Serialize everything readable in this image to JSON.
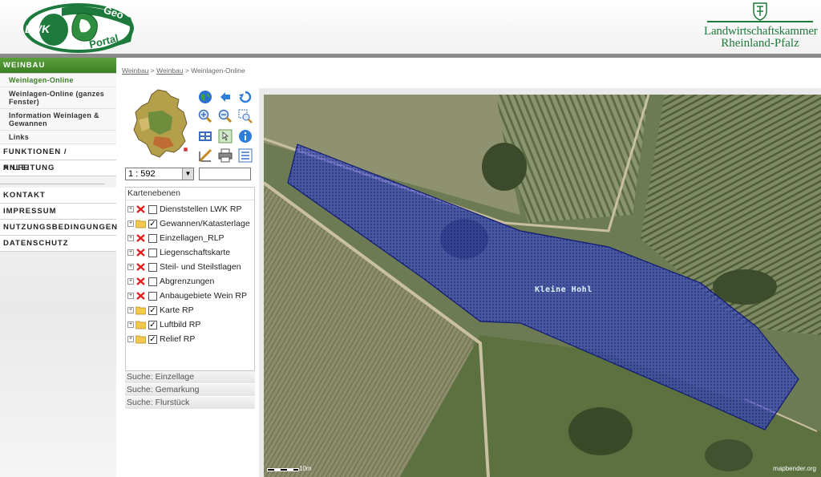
{
  "header": {
    "geo_logo": {
      "lwk": "LWK",
      "geo": "Geo",
      "portal": "Portal"
    },
    "lwk_logo": {
      "line1": "Landwirtschaftskammer",
      "line2": "Rheinland-Pfalz"
    }
  },
  "nav": {
    "weinbau": "WEINBAU",
    "sub": [
      "Weinlagen-Online",
      "Weinlagen-Online (ganzes Fenster)",
      "Information Weinlagen & Gewannen",
      "Links"
    ],
    "funktionen": "FUNKTIONEN / ANLEITUNG",
    "hilfe": "HILFE",
    "kontakt": "KONTAKT",
    "impressum": "IMPRESSUM",
    "nutzung": "NUTZUNGSBEDINGUNGEN",
    "datenschutz": "DATENSCHUTZ"
  },
  "breadcrumb": {
    "c1": "Weinbau",
    "sep1": " > ",
    "c2": "Weinbau",
    "sep2": " > ",
    "c3": "Weinlagen-Online"
  },
  "toolbar": {
    "icons": [
      "globe-icon",
      "back-icon",
      "refresh-icon",
      "zoom-in-icon",
      "zoom-out-icon",
      "zoom-box-icon",
      "layers-icon",
      "pan-icon",
      "info-icon",
      "measure-icon",
      "print-icon",
      "legend-icon"
    ]
  },
  "scale": {
    "value": "1 : 592"
  },
  "layers": {
    "title": "Kartenebenen",
    "items": [
      {
        "label": "Dienststellen LWK RP",
        "checked": false,
        "status": "disabled"
      },
      {
        "label": "Gewannen/Katasterlage",
        "checked": true,
        "status": "folder"
      },
      {
        "label": "Einzellagen_RLP",
        "checked": false,
        "status": "disabled"
      },
      {
        "label": "Liegenschaftskarte",
        "checked": false,
        "status": "disabled"
      },
      {
        "label": "Steil- und Steilstlagen",
        "checked": false,
        "status": "disabled"
      },
      {
        "label": "Abgrenzungen",
        "checked": false,
        "status": "disabled"
      },
      {
        "label": "Anbaugebiete Wein RP",
        "checked": false,
        "status": "disabled"
      },
      {
        "label": "Karte RP",
        "checked": true,
        "status": "folder"
      },
      {
        "label": "Luftbild RP",
        "checked": true,
        "status": "folder"
      },
      {
        "label": "Relief RP",
        "checked": true,
        "status": "folder"
      }
    ],
    "check_mark": "✓",
    "expand_mark": "+"
  },
  "search": {
    "einzellage": "Suche: Einzellage",
    "gemarkung": "Suche: Gemarkung",
    "flurstueck": "Suche: Flurstück"
  },
  "map": {
    "parcel_label": "Kleine Hohl",
    "scale_label": "10m",
    "credit": "mapbender.org",
    "colors": {
      "parcel_fill": "#2b3bd6",
      "parcel_border": "#101a70"
    }
  }
}
